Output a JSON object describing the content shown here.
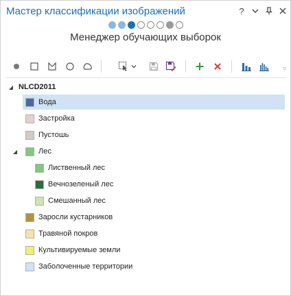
{
  "title": "Мастер классификации изображений",
  "title_controls": {
    "help": "?",
    "menu": "⌄",
    "pin": "📌",
    "close": "✕"
  },
  "steps": [
    "done",
    "done",
    "current",
    "todo",
    "todo",
    "todo",
    "opt",
    "todo"
  ],
  "subtitle": "Менеджер обучающих выборок",
  "tree": {
    "root": "NLCD2011",
    "items": [
      {
        "label": "Вода",
        "color": "#476ba0",
        "level": 1,
        "selected": true
      },
      {
        "label": "Застройка",
        "color": "#e7cfcf",
        "level": 1
      },
      {
        "label": "Пустошь",
        "color": "#d2cbc3",
        "level": 1
      },
      {
        "label": "Лес",
        "color": "#84c77f",
        "level": 1,
        "expanded": true
      },
      {
        "label": "Лиственный лес",
        "color": "#84c77f",
        "level": 2
      },
      {
        "label": "Вечнозеленый лес",
        "color": "#2f6b41",
        "level": 2
      },
      {
        "label": "Смешанный лес",
        "color": "#cfe4b7",
        "level": 2
      },
      {
        "label": "Заросли кустарников",
        "color": "#b09440",
        "level": 1
      },
      {
        "label": "Травяной покров",
        "color": "#f4e3ad",
        "level": 1
      },
      {
        "label": "Культивируемые земли",
        "color": "#eef06a",
        "level": 1
      },
      {
        "label": "Заболоченные территории",
        "color": "#cfe4f5",
        "level": 1
      }
    ]
  },
  "colors": {
    "accent": "#1e6fb5",
    "add": "#2e9b3e",
    "remove": "#d9363e",
    "selection": "#cfe3f5"
  }
}
